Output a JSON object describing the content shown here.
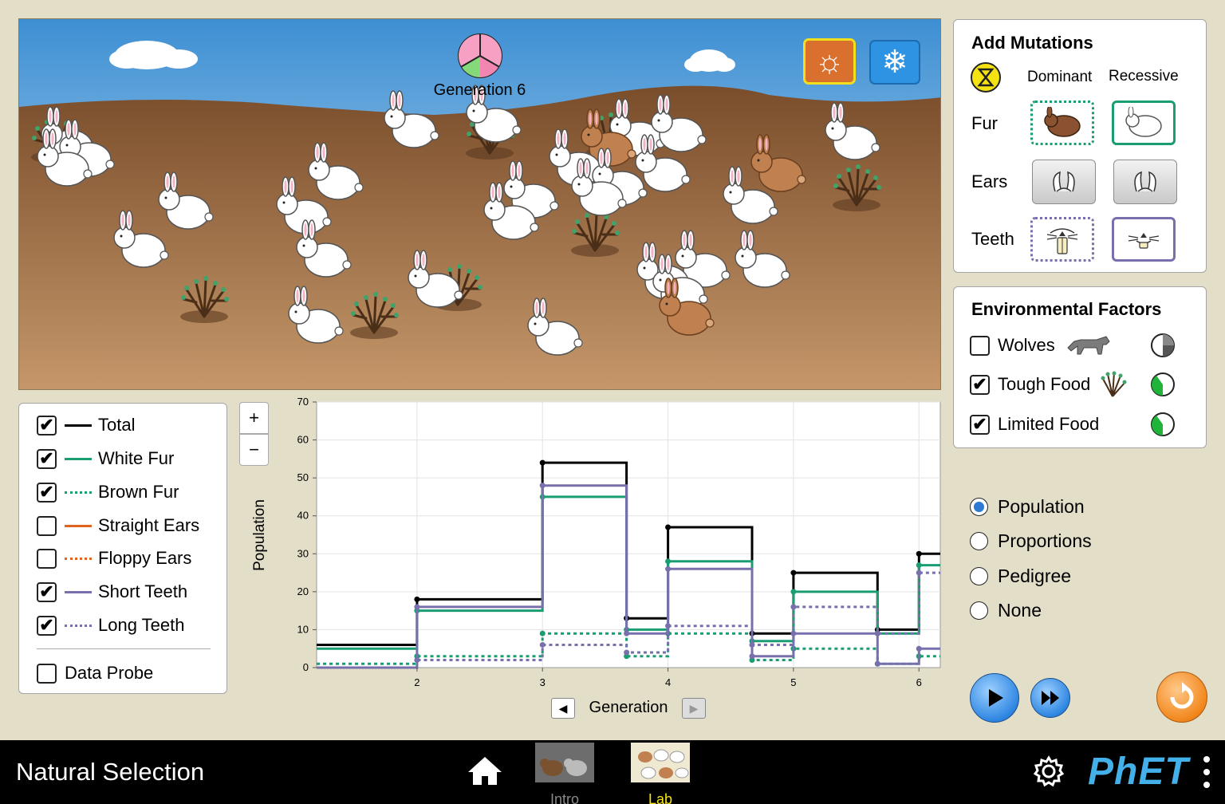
{
  "world": {
    "generation_label": "Generation 6",
    "sun_icon": "sun-icon",
    "snow_icon": "snowflake-icon"
  },
  "mutations": {
    "title": "Add Mutations",
    "dominant_label": "Dominant",
    "recessive_label": "Recessive",
    "rows": {
      "fur": "Fur",
      "ears": "Ears",
      "teeth": "Teeth"
    }
  },
  "environment": {
    "title": "Environmental Factors",
    "factors": [
      {
        "label": "Wolves",
        "checked": false
      },
      {
        "label": "Tough Food",
        "checked": true
      },
      {
        "label": "Limited Food",
        "checked": true
      }
    ]
  },
  "legend": {
    "items": [
      {
        "label": "Total",
        "checked": true,
        "color": "#000000",
        "dashed": false
      },
      {
        "label": "White Fur",
        "checked": true,
        "color": "#1a9d73",
        "dashed": false
      },
      {
        "label": "Brown Fur",
        "checked": true,
        "color": "#1a9d73",
        "dashed": true
      },
      {
        "label": "Straight Ears",
        "checked": false,
        "color": "#e0631e",
        "dashed": false
      },
      {
        "label": "Floppy Ears",
        "checked": false,
        "color": "#e0631e",
        "dashed": true
      },
      {
        "label": "Short Teeth",
        "checked": true,
        "color": "#7770ad",
        "dashed": false
      },
      {
        "label": "Long Teeth",
        "checked": true,
        "color": "#7770ad",
        "dashed": true
      }
    ],
    "data_probe": {
      "label": "Data Probe",
      "checked": false
    }
  },
  "graph": {
    "zoom_in": "+",
    "zoom_out": "−",
    "ylabel": "Population",
    "xlabel": "Generation"
  },
  "view_options": {
    "items": [
      "Population",
      "Proportions",
      "Pedigree",
      "None"
    ],
    "selected": "Population"
  },
  "navbar": {
    "title": "Natural Selection",
    "tabs": [
      "Intro",
      "Lab"
    ],
    "active_tab": "Lab",
    "logo_text": "PhET"
  },
  "chart_data": {
    "type": "line",
    "xlabel": "Generation",
    "ylabel": "Population",
    "xlim": [
      1.2,
      6.17
    ],
    "ylim": [
      0,
      70
    ],
    "x_ticks": [
      2,
      3,
      4,
      5,
      6
    ],
    "y_ticks": [
      0,
      10,
      20,
      30,
      40,
      50,
      60,
      70
    ],
    "grid": true,
    "step": true,
    "series": [
      {
        "name": "Total",
        "color": "#000000",
        "dashed": false,
        "points": [
          [
            1.2,
            6
          ],
          [
            2,
            6
          ],
          [
            2,
            18
          ],
          [
            3,
            18
          ],
          [
            3,
            54
          ],
          [
            3.67,
            54
          ],
          [
            3.67,
            13
          ],
          [
            4,
            13
          ],
          [
            4,
            37
          ],
          [
            4.67,
            37
          ],
          [
            4.67,
            9
          ],
          [
            5,
            9
          ],
          [
            5,
            25
          ],
          [
            5.67,
            25
          ],
          [
            5.67,
            10
          ],
          [
            6,
            10
          ],
          [
            6,
            30
          ],
          [
            6.17,
            30
          ]
        ],
        "markers": [
          [
            2,
            18
          ],
          [
            3,
            54
          ],
          [
            3.67,
            13
          ],
          [
            4,
            37
          ],
          [
            4.67,
            9
          ],
          [
            5,
            25
          ],
          [
            5.67,
            10
          ],
          [
            6,
            30
          ]
        ]
      },
      {
        "name": "White Fur",
        "color": "#1a9d73",
        "dashed": false,
        "points": [
          [
            1.2,
            5
          ],
          [
            2,
            5
          ],
          [
            2,
            15
          ],
          [
            3,
            15
          ],
          [
            3,
            45
          ],
          [
            3.67,
            45
          ],
          [
            3.67,
            10
          ],
          [
            4,
            10
          ],
          [
            4,
            28
          ],
          [
            4.67,
            28
          ],
          [
            4.67,
            7
          ],
          [
            5,
            7
          ],
          [
            5,
            20
          ],
          [
            5.67,
            20
          ],
          [
            5.67,
            9
          ],
          [
            6,
            9
          ],
          [
            6,
            27
          ],
          [
            6.17,
            27
          ]
        ],
        "markers": [
          [
            2,
            15
          ],
          [
            3,
            45
          ],
          [
            3.67,
            10
          ],
          [
            4,
            28
          ],
          [
            4.67,
            7
          ],
          [
            5,
            20
          ],
          [
            5.67,
            9
          ],
          [
            6,
            27
          ]
        ]
      },
      {
        "name": "Brown Fur",
        "color": "#1a9d73",
        "dashed": true,
        "points": [
          [
            1.2,
            1
          ],
          [
            2,
            1
          ],
          [
            2,
            3
          ],
          [
            3,
            3
          ],
          [
            3,
            9
          ],
          [
            3.67,
            9
          ],
          [
            3.67,
            3
          ],
          [
            4,
            3
          ],
          [
            4,
            9
          ],
          [
            4.67,
            9
          ],
          [
            4.67,
            2
          ],
          [
            5,
            2
          ],
          [
            5,
            5
          ],
          [
            5.67,
            5
          ],
          [
            5.67,
            1
          ],
          [
            6,
            1
          ],
          [
            6,
            3
          ],
          [
            6.17,
            3
          ]
        ],
        "markers": [
          [
            2,
            3
          ],
          [
            3,
            9
          ],
          [
            3.67,
            3
          ],
          [
            4,
            9
          ],
          [
            4.67,
            2
          ],
          [
            5,
            5
          ],
          [
            5.67,
            1
          ],
          [
            6,
            3
          ]
        ]
      },
      {
        "name": "Short Teeth",
        "color": "#7770ad",
        "dashed": false,
        "points": [
          [
            1.2,
            0
          ],
          [
            2,
            0
          ],
          [
            2,
            16
          ],
          [
            3,
            16
          ],
          [
            3,
            48
          ],
          [
            3.67,
            48
          ],
          [
            3.67,
            9
          ],
          [
            4,
            9
          ],
          [
            4,
            26
          ],
          [
            4.67,
            26
          ],
          [
            4.67,
            3
          ],
          [
            5,
            3
          ],
          [
            5,
            9
          ],
          [
            5.67,
            9
          ],
          [
            5.67,
            1
          ],
          [
            6,
            1
          ],
          [
            6,
            5
          ],
          [
            6.17,
            5
          ]
        ],
        "markers": [
          [
            2,
            16
          ],
          [
            3,
            48
          ],
          [
            3.67,
            9
          ],
          [
            4,
            26
          ],
          [
            4.67,
            3
          ],
          [
            5,
            9
          ],
          [
            5.67,
            1
          ],
          [
            6,
            5
          ]
        ]
      },
      {
        "name": "Long Teeth",
        "color": "#7770ad",
        "dashed": true,
        "points": [
          [
            1.2,
            0
          ],
          [
            2,
            0
          ],
          [
            2,
            2
          ],
          [
            3,
            2
          ],
          [
            3,
            6
          ],
          [
            3.67,
            6
          ],
          [
            3.67,
            4
          ],
          [
            4,
            4
          ],
          [
            4,
            11
          ],
          [
            4.67,
            11
          ],
          [
            4.67,
            6
          ],
          [
            5,
            6
          ],
          [
            5,
            16
          ],
          [
            5.67,
            16
          ],
          [
            5.67,
            9
          ],
          [
            6,
            9
          ],
          [
            6,
            25
          ],
          [
            6.17,
            25
          ]
        ],
        "markers": [
          [
            2,
            2
          ],
          [
            3,
            6
          ],
          [
            3.67,
            4
          ],
          [
            4,
            11
          ],
          [
            4.67,
            6
          ],
          [
            5,
            16
          ],
          [
            5.67,
            9
          ],
          [
            6,
            25
          ]
        ]
      }
    ]
  }
}
